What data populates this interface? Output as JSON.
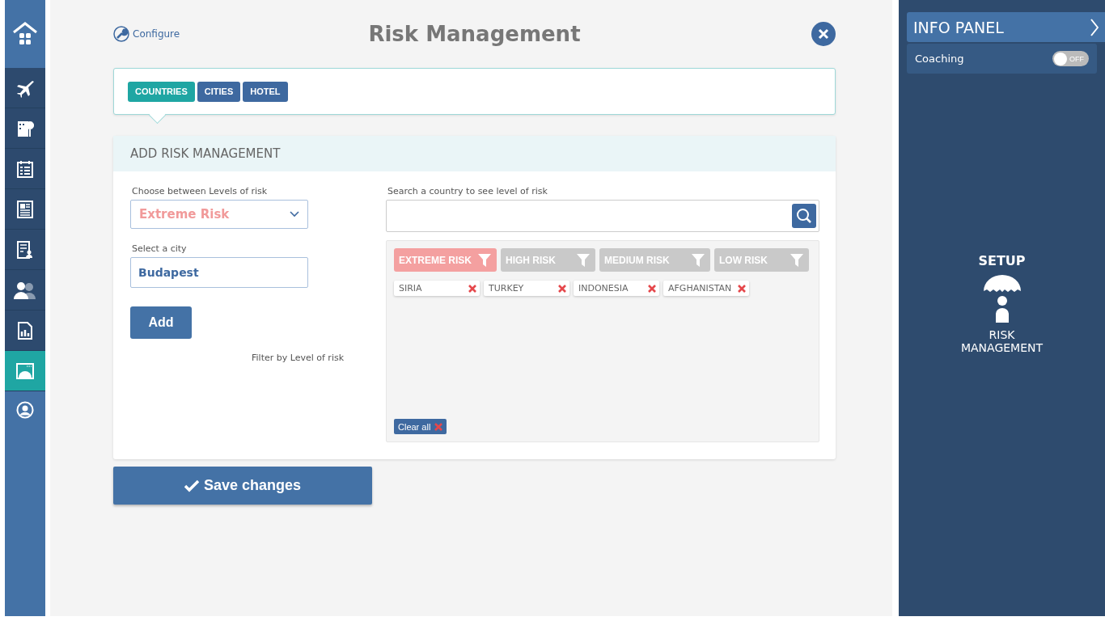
{
  "sidebar": {
    "items": [
      {
        "kind": "home",
        "selected": false
      },
      {
        "kind": "nav",
        "selected": false
      },
      {
        "kind": "nav",
        "selected": false
      },
      {
        "kind": "nav",
        "selected": false
      },
      {
        "kind": "nav",
        "selected": false
      },
      {
        "kind": "nav",
        "selected": false
      },
      {
        "kind": "nav",
        "selected": false
      },
      {
        "kind": "nav",
        "selected": false
      },
      {
        "kind": "nav",
        "selected": true
      },
      {
        "kind": "profile",
        "selected": false
      }
    ]
  },
  "header": {
    "configure": "Configure",
    "title": "Risk Management"
  },
  "tabs": [
    {
      "label": "COUNTRIES",
      "selected": true
    },
    {
      "label": "CITIES",
      "selected": false
    },
    {
      "label": "HOTEL",
      "selected": false
    }
  ],
  "form": {
    "title": "ADD RISK MANAGEMENT",
    "level_label": "Choose between Levels of risk",
    "level_value": "Extreme Risk",
    "city_label": "Select a city",
    "city_value": "Budapest",
    "add_button": "Add",
    "filter_note": "Filter by Level of risk",
    "search_label": "Search a country to see level of risk",
    "filters": [
      {
        "label": "EXTREME RISK",
        "selected": true
      },
      {
        "label": "HIGH RISK",
        "selected": false
      },
      {
        "label": "MEDIUM RISK",
        "selected": false
      },
      {
        "label": "LOW RISK",
        "selected": false
      }
    ],
    "tags": [
      "SIRIA",
      "TURKEY",
      "INDONESIA",
      "AFGHANISTAN"
    ],
    "clear_all": "Clear all"
  },
  "save_button": "Save changes",
  "info_panel": {
    "title": "INFO PANEL",
    "coaching": {
      "label": "Coaching",
      "on": false,
      "state_label": "OFF"
    },
    "section": "SETUP",
    "item": "RISK MANAGEMENT"
  }
}
